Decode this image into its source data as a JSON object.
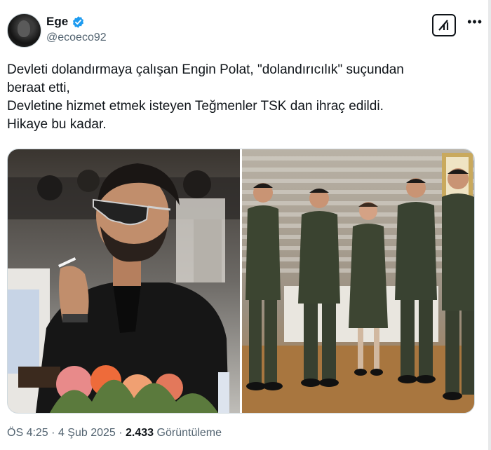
{
  "author": {
    "display_name": "Ege",
    "handle": "@ecoeco92",
    "verified_icon": "verified-badge-icon",
    "badge_color": "#1d9bf0"
  },
  "tweet": {
    "lines": [
      "Devleti dolandırmaya çalışan Engin Polat, \"dolandırıcılık\" suçundan",
      "beraat etti,",
      "Devletine hizmet etmek isteyen Teğmenler TSK dan ihraç edildi.",
      "Hikaye bu kadar."
    ]
  },
  "media": {
    "images": [
      {
        "icon": "photo-man-sunglasses-icon"
      },
      {
        "icon": "photo-lieutenants-uniform-icon"
      }
    ]
  },
  "footer": {
    "time": "ÖS 4:25",
    "separator": "·",
    "date": "4 Şub 2025",
    "views_count": "2.433",
    "views_label": "Görüntüleme"
  },
  "colors": {
    "text": "#0f1419",
    "secondary": "#536471",
    "border": "#cfd9de"
  }
}
